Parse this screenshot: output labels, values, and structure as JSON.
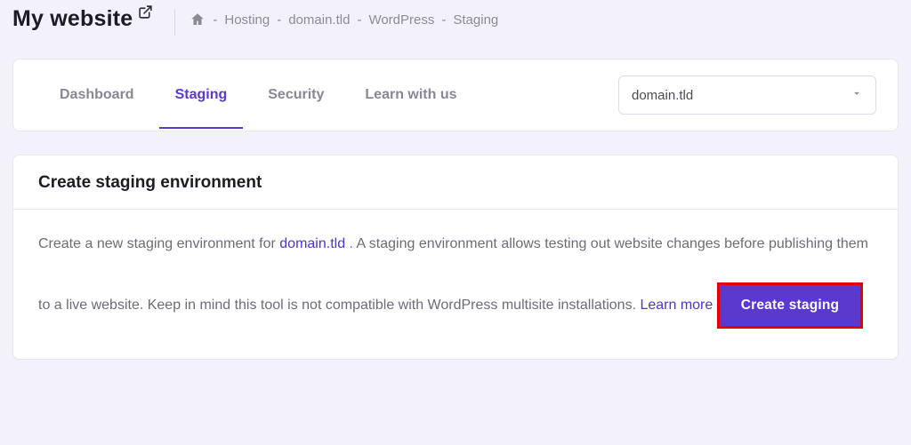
{
  "site_title": "My website",
  "breadcrumbs": {
    "hosting": "Hosting",
    "domain": "domain.tld",
    "wordpress": "WordPress",
    "staging": "Staging"
  },
  "tabs": {
    "dashboard": "Dashboard",
    "staging": "Staging",
    "security": "Security",
    "learn": "Learn with us"
  },
  "domain_select": {
    "value": "domain.tld"
  },
  "panel": {
    "title": "Create staging environment",
    "text_before": "Create a new staging environment for ",
    "domain": "domain.tld",
    "text_after": " . A staging environment allows testing out website changes before publishing them to a live website. Keep in mind this tool is not compatible with WordPress multisite installations. ",
    "learn_more": "Learn more"
  },
  "cta_label": "Create staging",
  "colors": {
    "accent": "#5a39cf",
    "highlight": "#e70000"
  }
}
